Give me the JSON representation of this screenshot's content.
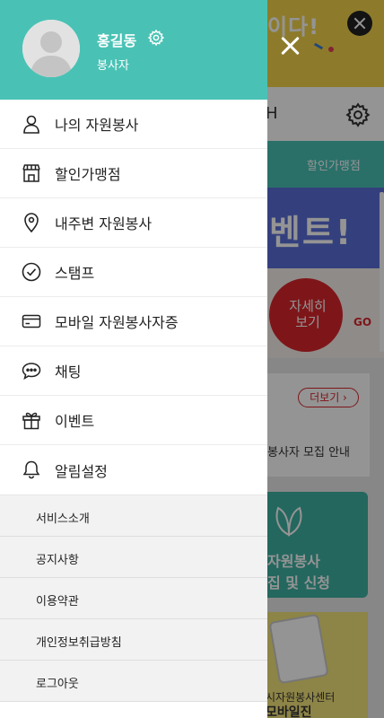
{
  "background": {
    "banner_text": "이다!",
    "header_char": "H",
    "tab_label": "할인가맹점",
    "event_title": "벤트!",
    "event_circle_text": "자세히 보기",
    "event_go": "GO",
    "more_button": "더보기 ›",
    "notice_text": "봉사자 모집 안내",
    "green_text1": "자원봉사",
    "green_text2": "집 및 신청",
    "mobile_text1": "시자원봉사센터",
    "mobile_text2": "모바일진"
  },
  "profile": {
    "name": "홍길동",
    "role": "봉사자"
  },
  "menu": {
    "items": [
      {
        "label": "나의 자원봉사",
        "icon": "person-icon"
      },
      {
        "label": "할인가맹점",
        "icon": "store-icon"
      },
      {
        "label": "내주변 자원봉사",
        "icon": "location-pin-icon"
      },
      {
        "label": "스탬프",
        "icon": "check-circle-icon"
      },
      {
        "label": "모바일 자원봉사자증",
        "icon": "card-icon"
      },
      {
        "label": "채팅",
        "icon": "chat-bubble-icon"
      },
      {
        "label": "이벤트",
        "icon": "gift-icon"
      },
      {
        "label": "알림설정",
        "icon": "bell-icon"
      }
    ]
  },
  "submenu": {
    "items": [
      {
        "label": "서비스소개"
      },
      {
        "label": "공지사항"
      },
      {
        "label": "이용약관"
      },
      {
        "label": "개인정보취급방침"
      },
      {
        "label": "로그아웃"
      }
    ]
  },
  "colors": {
    "accent": "#49c2b5",
    "overlay": "rgba(0,0,0,0.42)"
  }
}
